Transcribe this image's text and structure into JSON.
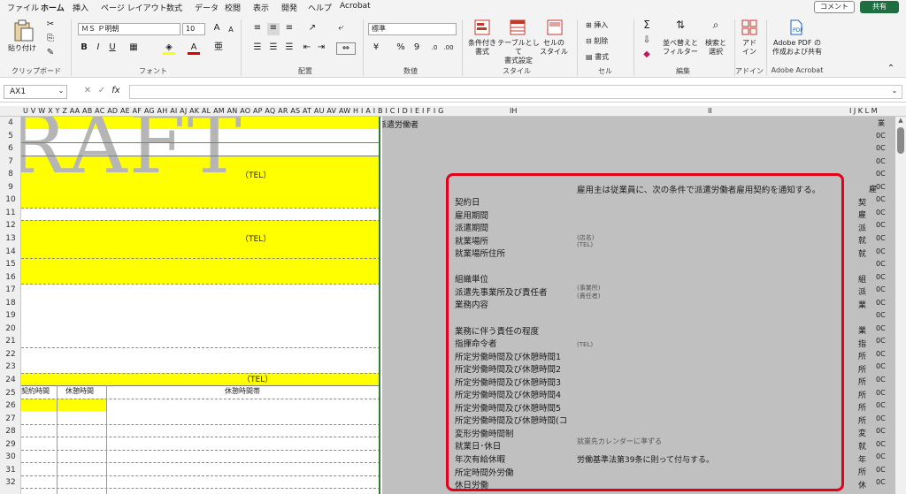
{
  "tabs": [
    "ファイル",
    "ホーム",
    "挿入",
    "ページ レイアウト",
    "数式",
    "データ",
    "校閲",
    "表示",
    "開発",
    "ヘルプ",
    "Acrobat"
  ],
  "active_tab": "ホーム",
  "comment_label": "コメント",
  "share_label": "共有",
  "ribbon": {
    "clipboard": {
      "paste": "貼り付け",
      "label": "クリップボード"
    },
    "font": {
      "name": "ＭＳ Ｐ明朝",
      "size": "10",
      "bold": "B",
      "italic": "I",
      "underline": "U",
      "grow": "A",
      "shrink": "A",
      "label": "フォント"
    },
    "align": {
      "label": "配置"
    },
    "number": {
      "format": "標準",
      "percent": "%",
      "comma": "9",
      "label": "数値"
    },
    "style": {
      "conditional": "条件付き\n書式",
      "table": "テーブルとして\n書式設定",
      "cell": "セルの\nスタイル",
      "label": "スタイル"
    },
    "cells": {
      "insert": "挿入",
      "delete": "削除",
      "format": "書式",
      "label": "セル"
    },
    "edit": {
      "sum": "Σ",
      "sort": "並べ替えと\nフィルター",
      "find": "検索と\n選択",
      "label": "編集"
    },
    "addin": {
      "addin": "アド\nイン",
      "label": "アドイン"
    },
    "acrobat": {
      "pdf": "Adobe PDF の\n作成および共有",
      "label": "Adobe Acrobat"
    }
  },
  "namebox": "AX1",
  "fx": "fx",
  "col_headers_left": "U V W X Y Z AA AB AC AD AE AF AG AH AI AJ AK AL AM AN AO AP AQ AR AS AT AU AV AW H I A I B I C I D I E I F I G",
  "col_header_ih": "IH",
  "col_header_ii": "II",
  "col_header_right": "I J K L M",
  "rows": [
    "4",
    "5",
    "6",
    "7",
    "8",
    "9",
    "10",
    "11",
    "12",
    "13",
    "14",
    "15",
    "16",
    "17",
    "18",
    "19",
    "20",
    "21",
    "22",
    "23",
    "24",
    "25",
    "26",
    "27",
    "28",
    "29",
    "30",
    "31",
    "32"
  ],
  "draft_text": "RAFT",
  "tel": [
    "（TEL）",
    "（TEL）",
    "（TEL）"
  ],
  "left_headers": [
    "契約時間",
    "休憩時間",
    "休憩時間帯"
  ],
  "row4_text": "派遣労働者",
  "notice": "雇用主は従業員に、次の条件で派遣労働者雇用契約を通知する。",
  "labels": [
    "契約日",
    "雇用期間",
    "派遣期間",
    "就業場所",
    "就業場所住所",
    "",
    "組織単位",
    "派遣先事業所及び責任者",
    "業務内容",
    "",
    "業務に伴う責任の程度",
    "指揮命令者",
    "所定労働時間及び休憩時間1",
    "所定労働時間及び休憩時間2",
    "所定労働時間及び休憩時間3",
    "所定労働時間及び休憩時間4",
    "所定労働時間及び休憩時間5",
    "所定労働時間及び休憩時間(コ",
    "変形労働時間制",
    "就業日･休日",
    "年次有給休暇",
    "所定時間外労働",
    "休日労働"
  ],
  "values": {
    "shop": "(店名)",
    "tel1": "(TEL)",
    "office": "(事業所)",
    "resp": "(責任者)",
    "tel2": "(TEL)",
    "calendar": "就業先カレンダーに準ずる",
    "leave": "労働基準法第39条に則って付与する。"
  },
  "right_col_b": [
    "雇",
    "契",
    "雇",
    "派",
    "就",
    "就",
    "",
    "組",
    "派",
    "業",
    "",
    "業",
    "指",
    "所",
    "所",
    "所",
    "所",
    "所",
    "所",
    "変",
    "就",
    "年",
    "所",
    "休"
  ],
  "right_col_c": [
    "業",
    "0C",
    "0C",
    "0C",
    "0C",
    "0C",
    "0C",
    "0C",
    "0C",
    "0C",
    "0C",
    "0C",
    "0C",
    "0C",
    "0C",
    "0C",
    "0C",
    "0C",
    "0C",
    "0C",
    "0C",
    "0C",
    "0C",
    "0C",
    "0C",
    "0C",
    "0C",
    "0C",
    "0C"
  ]
}
